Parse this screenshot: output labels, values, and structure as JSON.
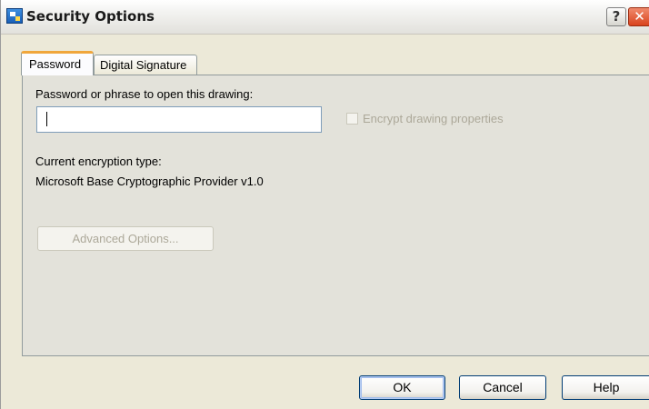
{
  "window": {
    "title": "Security Options",
    "help_glyph": "?",
    "close_glyph": "✕",
    "icon": "security-options-app-icon"
  },
  "tabs": [
    {
      "label": "Password",
      "selected": true
    },
    {
      "label": "Digital Signature",
      "selected": false
    }
  ],
  "password_tab": {
    "password_label": "Password or phrase to open this drawing:",
    "password_value": "",
    "encrypt_checkbox": {
      "label": "Encrypt drawing properties",
      "checked": false,
      "enabled": false
    },
    "encryption_type_label": "Current encryption type:",
    "encryption_provider": "Microsoft Base Cryptographic Provider v1.0",
    "advanced_button_label": "Advanced Options..."
  },
  "buttons": {
    "ok": "OK",
    "cancel": "Cancel",
    "help": "Help"
  },
  "colors": {
    "dialog_bg": "#ece9d8",
    "panel_bg": "#e3e2da",
    "selected_tab_accent": "#f0a63b",
    "default_button_border": "#003c74",
    "disabled_text": "#aca899",
    "close_button": "#d9431e"
  }
}
